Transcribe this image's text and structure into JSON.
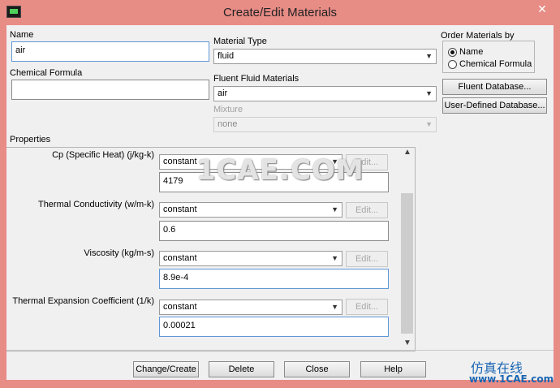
{
  "window": {
    "title": "Create/Edit Materials",
    "close_glyph": "✕"
  },
  "name": {
    "label": "Name",
    "value": "air"
  },
  "chemical_formula": {
    "label": "Chemical Formula",
    "value": ""
  },
  "material_type": {
    "label": "Material Type",
    "value": "fluid"
  },
  "fluent_fluid_materials": {
    "label": "Fluent Fluid Materials",
    "value": "air"
  },
  "mixture": {
    "label": "Mixture",
    "value": "none"
  },
  "order_by": {
    "label": "Order Materials by",
    "options": [
      "Name",
      "Chemical Formula"
    ],
    "selected": "Name"
  },
  "right_buttons": {
    "fluent_database": "Fluent Database...",
    "user_defined_database": "User-Defined Database..."
  },
  "properties": {
    "label": "Properties",
    "items": [
      {
        "label": "Cp (Specific Heat) (j/kg-k)",
        "method": "constant",
        "edit": "Edit...",
        "value": "4179"
      },
      {
        "label": "Thermal Conductivity (w/m-k)",
        "method": "constant",
        "edit": "Edit...",
        "value": "0.6"
      },
      {
        "label": "Viscosity (kg/m-s)",
        "method": "constant",
        "edit": "Edit...",
        "value": "8.9e-4"
      },
      {
        "label": "Thermal Expansion Coefficient (1/k)",
        "method": "constant",
        "edit": "Edit...",
        "value": "0.00021"
      }
    ]
  },
  "bottom_buttons": {
    "change_create": "Change/Create",
    "delete": "Delete",
    "close": "Close",
    "help": "Help"
  },
  "watermark": {
    "main": "1CAE.COM",
    "cn": "仿真在线",
    "url": "www.1CAE.com"
  }
}
